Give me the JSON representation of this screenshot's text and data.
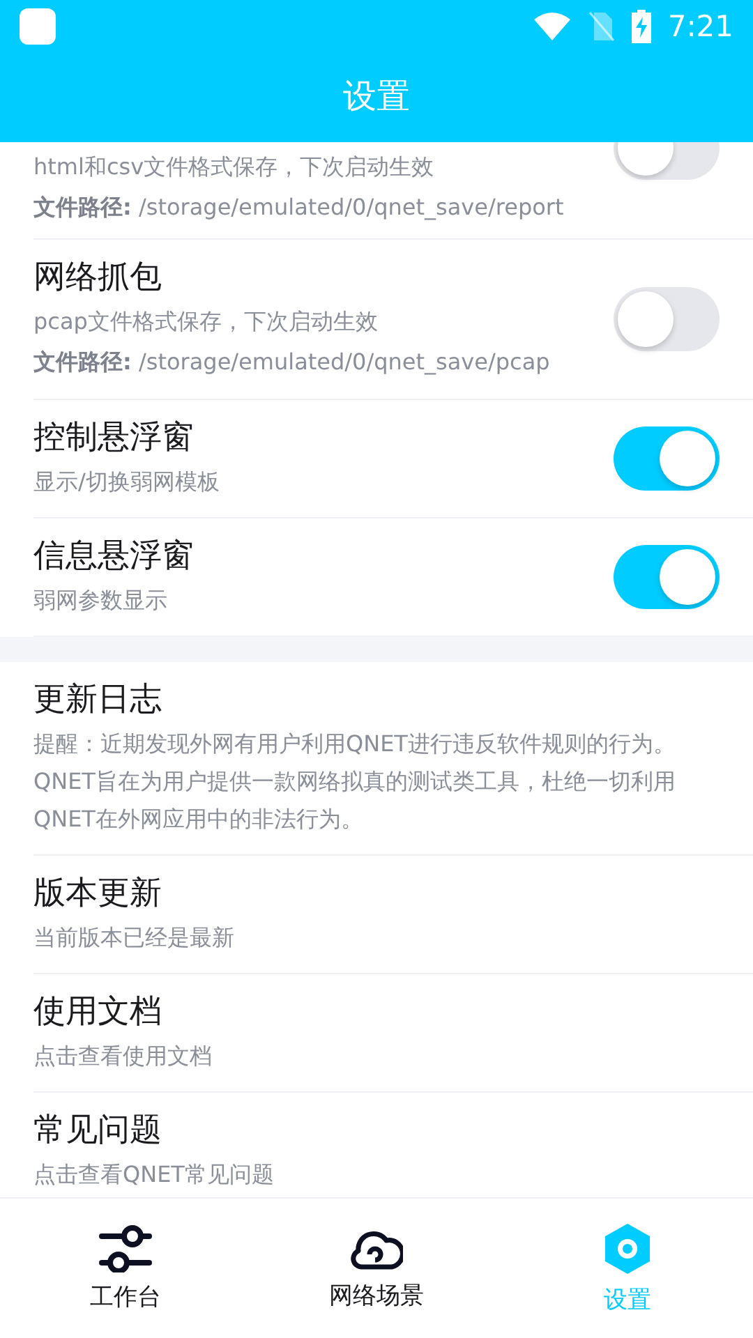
{
  "status_bar": {
    "time": "7:21"
  },
  "header": {
    "title": "设置"
  },
  "settings": [
    {
      "description": "html和csv文件格式保存，下次启动生效",
      "path": "**文件路径:** /storage/emulated/0/qnet_save/report",
      "on": false,
      "cut": true
    },
    {
      "title": "网络抓包",
      "description": "pcap文件格式保存，下次启动生效",
      "path": "**文件路径:** /storage/emulated/0/qnet_save/pcap",
      "on": false
    },
    {
      "title": "控制悬浮窗",
      "description": "显示/切换弱网模板",
      "on": true
    },
    {
      "title": "信息悬浮窗",
      "description": "弱网参数显示",
      "on": true
    }
  ],
  "info": [
    {
      "title": "更新日志",
      "description": "提醒：近期发现外网有用户利用QNET进行违反软件规则的行为。QNET旨在为用户提供一款网络拟真的测试类工具，杜绝一切利用QNET在外网应用中的非法行为。"
    },
    {
      "title": "版本更新",
      "description": "当前版本已经是最新"
    },
    {
      "title": "使用文档",
      "description": "点击查看使用文档"
    },
    {
      "title": "常见问题",
      "description": "点击查看QNET常见问题"
    }
  ],
  "tabs": [
    {
      "label": "工作台",
      "kind": "sliders",
      "selected": false
    },
    {
      "label": "网络场景",
      "kind": "cloud",
      "selected": false
    },
    {
      "label": "设置",
      "kind": "hexagon",
      "selected": true
    }
  ]
}
